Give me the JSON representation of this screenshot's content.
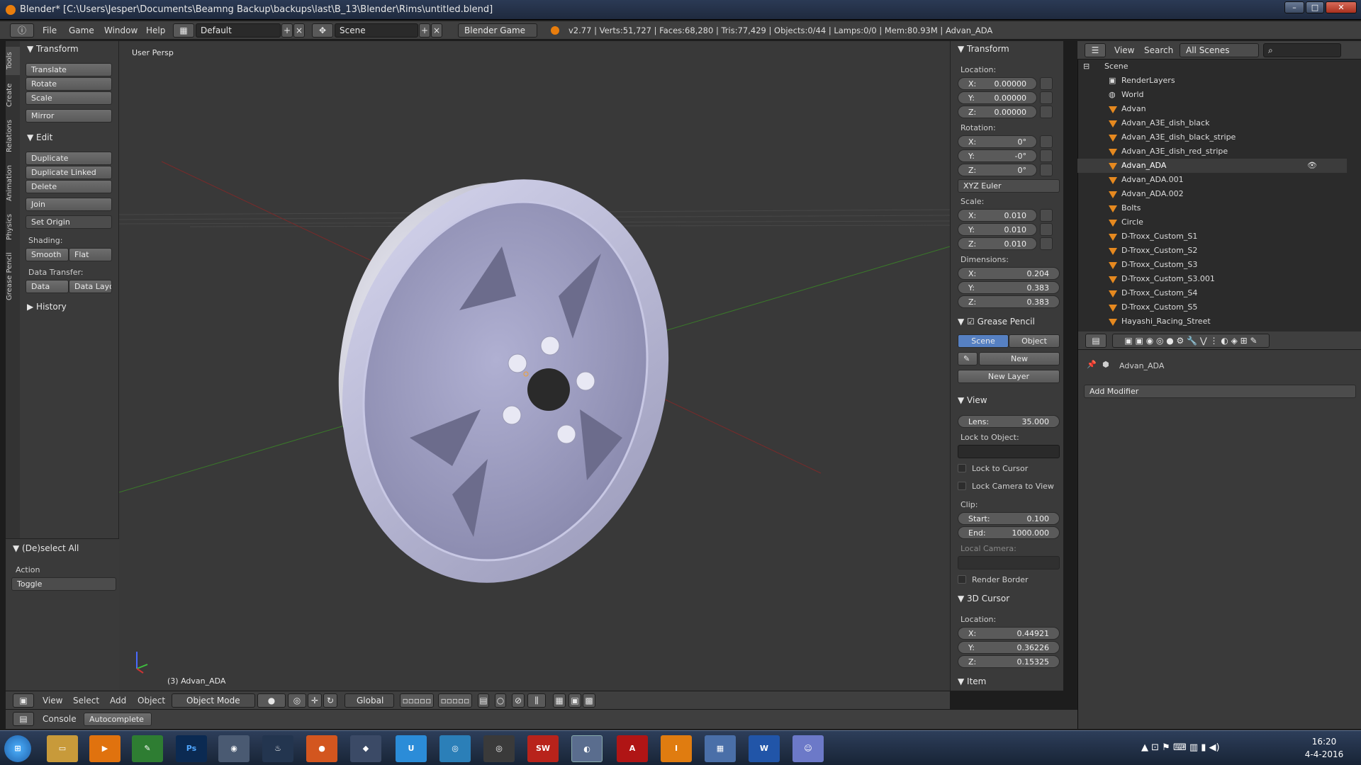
{
  "window": {
    "title": "Blender* [C:\\Users\\Jesper\\Documents\\Beamng Backup\\backups\\last\\B_13\\Blender\\Rims\\untitled.blend]"
  },
  "topbar": {
    "menus": [
      "File",
      "Game",
      "Window",
      "Help"
    ],
    "layout": "Default",
    "scene": "Scene",
    "engine": "Blender Game",
    "stats": "v2.77 | Verts:51,727 | Faces:68,280 | Tris:77,429 | Objects:0/44 | Lamps:0/0 | Mem:80.93M | Advan_ADA"
  },
  "side_tabs": [
    "Tools",
    "Create",
    "Relations",
    "Animation",
    "Physics",
    "Grease Pencil"
  ],
  "toolshelf": {
    "transform_header": "Transform",
    "translate": "Translate",
    "rotate": "Rotate",
    "scale": "Scale",
    "mirror": "Mirror",
    "edit_header": "Edit",
    "duplicate": "Duplicate",
    "duplicate_linked": "Duplicate Linked",
    "delete": "Delete",
    "join": "Join",
    "set_origin": "Set Origin",
    "shading_label": "Shading:",
    "smooth": "Smooth",
    "flat": "Flat",
    "data_transfer_label": "Data Transfer:",
    "data": "Data",
    "data_layo": "Data Layo",
    "history_header": "History",
    "deselect_header": "(De)select All",
    "action_label": "Action",
    "toggle": "Toggle"
  },
  "viewport": {
    "view_name": "User Persp",
    "object_label": "(3) Advan_ADA"
  },
  "vpheader": {
    "menus": [
      "View",
      "Select",
      "Add",
      "Object"
    ],
    "mode": "Object Mode",
    "orientation": "Global"
  },
  "console": {
    "console_tab": "Console",
    "autocomplete": "Autocomplete"
  },
  "npanel": {
    "transform_header": "Transform",
    "location_label": "Location:",
    "location": [
      {
        "k": "X:",
        "v": "0.00000"
      },
      {
        "k": "Y:",
        "v": "0.00000"
      },
      {
        "k": "Z:",
        "v": "0.00000"
      }
    ],
    "rotation_label": "Rotation:",
    "rotation": [
      {
        "k": "X:",
        "v": "0°"
      },
      {
        "k": "Y:",
        "v": "-0°"
      },
      {
        "k": "Z:",
        "v": "0°"
      }
    ],
    "rotation_mode": "XYZ Euler",
    "scale_label": "Scale:",
    "scale": [
      {
        "k": "X:",
        "v": "0.010"
      },
      {
        "k": "Y:",
        "v": "0.010"
      },
      {
        "k": "Z:",
        "v": "0.010"
      }
    ],
    "dimensions_label": "Dimensions:",
    "dimensions": [
      {
        "k": "X:",
        "v": "0.204"
      },
      {
        "k": "Y:",
        "v": "0.383"
      },
      {
        "k": "Z:",
        "v": "0.383"
      }
    ],
    "grease_header": "Grease Pencil",
    "scene_tab": "Scene",
    "object_tab": "Object",
    "new": "New",
    "new_layer": "New Layer",
    "view_header": "View",
    "lens_label": "Lens:",
    "lens": "35.000",
    "lock_to_object": "Lock to Object:",
    "lock_to_cursor": "Lock to Cursor",
    "lock_camera": "Lock Camera to View",
    "clip_label": "Clip:",
    "clip_start_label": "Start:",
    "clip_start": "0.100",
    "clip_end_label": "End:",
    "clip_end": "1000.000",
    "local_camera": "Local Camera:",
    "render_border": "Render Border",
    "cursor_header": "3D Cursor",
    "cursor_location_label": "Location:",
    "cursor": [
      {
        "k": "X:",
        "v": "0.44921"
      },
      {
        "k": "Y:",
        "v": "0.36226"
      },
      {
        "k": "Z:",
        "v": "0.15325"
      }
    ],
    "item_header": "Item"
  },
  "outliner": {
    "view": "View",
    "search": "Search",
    "scenes": "All Scenes",
    "items": [
      "Scene",
      "RenderLayers",
      "World",
      "Advan",
      "Advan_A3E_dish_black",
      "Advan_A3E_dish_black_stripe",
      "Advan_A3E_dish_red_stripe",
      "Advan_ADA",
      "Advan_ADA.001",
      "Advan_ADA.002",
      "Bolts",
      "Circle",
      "D-Troxx_Custom_S1",
      "D-Troxx_Custom_S2",
      "D-Troxx_Custom_S3",
      "D-Troxx_Custom_S3.001",
      "D-Troxx_Custom_S4",
      "D-Troxx_Custom_S5",
      "Hayashi_Racing_Street"
    ]
  },
  "properties": {
    "object": "Advan_ADA",
    "add_modifier": "Add Modifier"
  },
  "taskbar": {
    "time": "16:20",
    "date": "4-4-2016"
  },
  "colors": {
    "accent": "#5680c2",
    "object_orange": "#e6891f",
    "background": "#393939"
  }
}
